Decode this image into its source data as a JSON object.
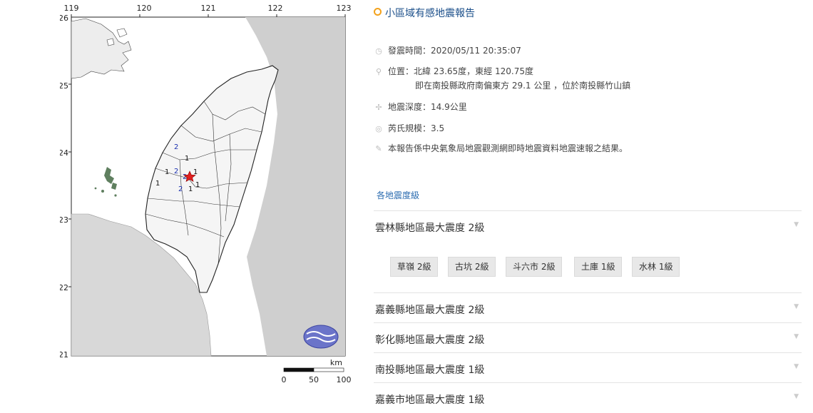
{
  "map": {
    "lon_ticks": [
      "119",
      "120",
      "121",
      "122",
      "123"
    ],
    "lat_ticks": [
      "26",
      "25",
      "24",
      "23",
      "22",
      "21"
    ],
    "scale_unit": "km",
    "scale_labels": [
      "0",
      "50",
      "100"
    ],
    "intensity_labels": [
      {
        "text": "2",
        "color": "#1a2fb0"
      },
      {
        "text": "1",
        "color": "#111111"
      },
      {
        "text": "1",
        "color": "#111111"
      },
      {
        "text": "2",
        "color": "#1a2fb0"
      },
      {
        "text": "2",
        "color": "#1a2fb0"
      },
      {
        "text": "1",
        "color": "#111111"
      },
      {
        "text": "1",
        "color": "#111111"
      },
      {
        "text": "1",
        "color": "#111111"
      },
      {
        "text": "2",
        "color": "#1a2fb0"
      },
      {
        "text": "1",
        "color": "#111111"
      }
    ],
    "epicenter_color": "#e02020"
  },
  "report": {
    "title": "小區域有感地震報告",
    "time": "發震時間：2020/05/11 20:35:07",
    "location": "位置：北緯 23.65度，東經 120.75度",
    "location_detail": "即在南投縣政府南偏東方 29.1 公里 ，位於南投縣竹山鎮",
    "depth": "地震深度：14.9公里",
    "magnitude": "芮氏規模：3.5",
    "note": "本報告係中央氣象局地震觀測網即時地震資料地震速報之結果。",
    "section_link": "各地震度級",
    "counties": [
      {
        "label": "雲林縣地區最大震度 2級"
      },
      {
        "label": "嘉義縣地區最大震度 2級"
      },
      {
        "label": "彰化縣地區最大震度 2級"
      },
      {
        "label": "南投縣地區最大震度 1級"
      },
      {
        "label": "嘉義市地區最大震度 1級"
      }
    ],
    "stations": [
      "草嶺 2級",
      "古坑 2級",
      "斗六市 2級",
      "土庫 1級",
      "水林 1級"
    ]
  }
}
